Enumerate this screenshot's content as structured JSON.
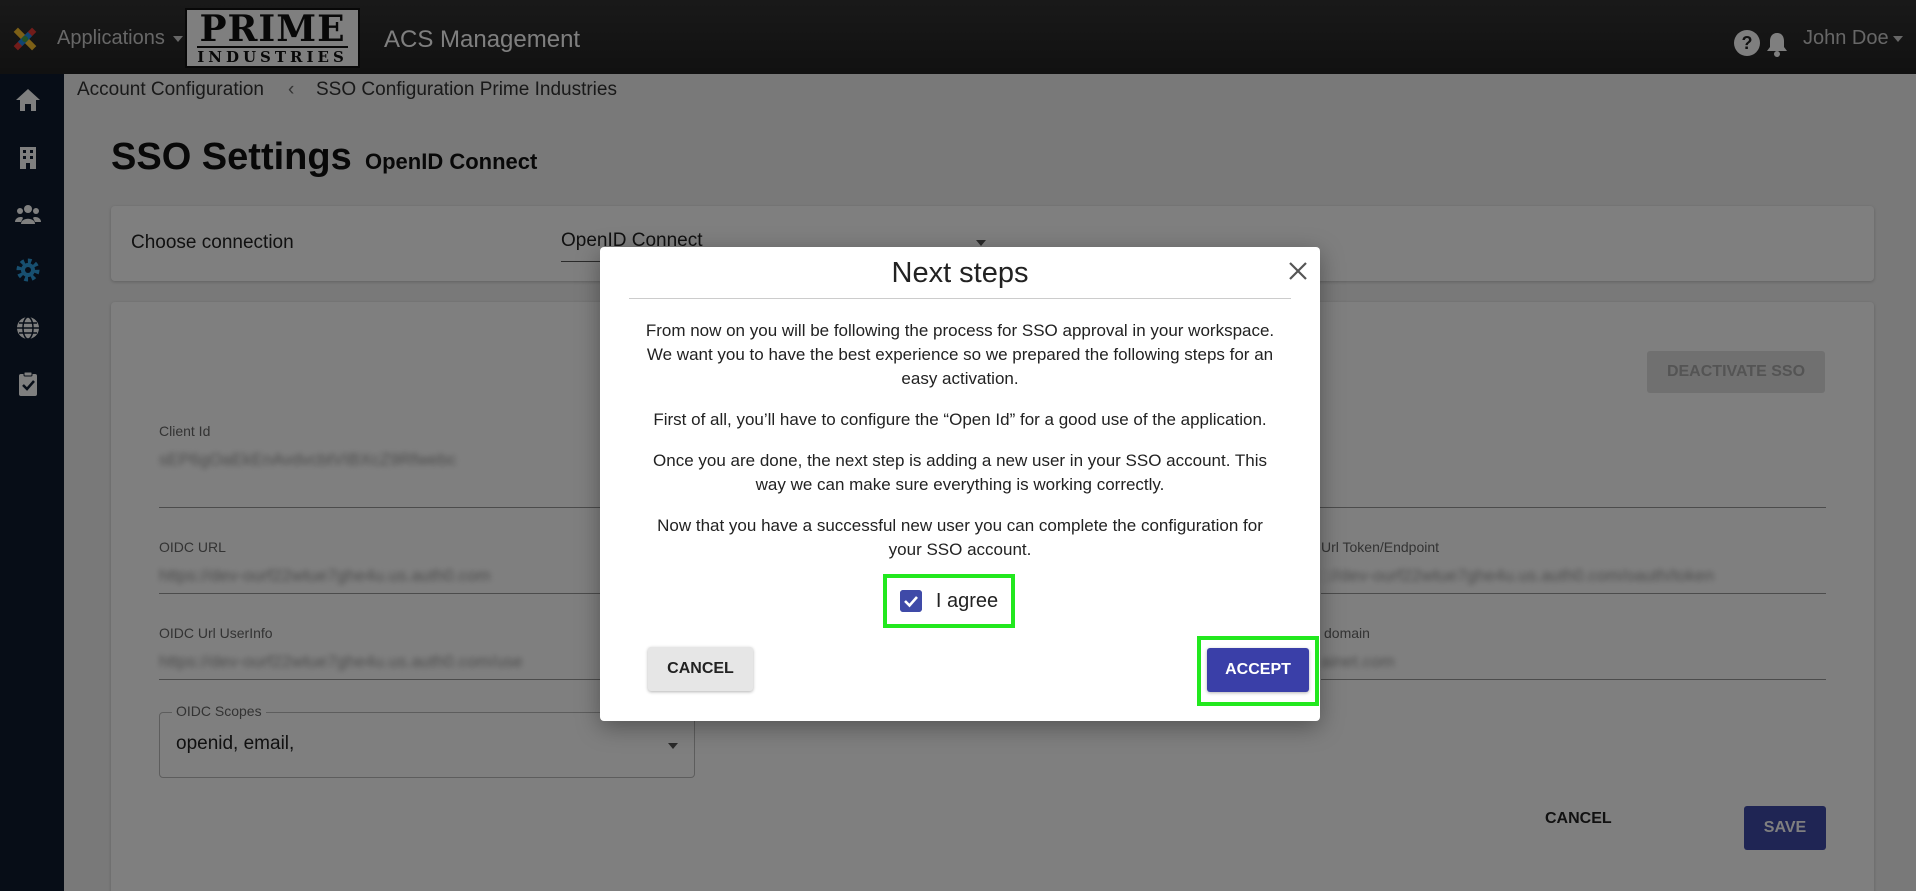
{
  "header": {
    "apps_label": "Applications",
    "brand_line1": "PRIME",
    "brand_line2": "INDUSTRIES",
    "product": "ACS Management",
    "help": "?",
    "user": "John Doe"
  },
  "sidebar": {
    "items": [
      {
        "icon": "home-icon"
      },
      {
        "icon": "building-icon"
      },
      {
        "icon": "users-icon"
      },
      {
        "icon": "gear-icon",
        "active": true
      },
      {
        "icon": "globe-icon"
      },
      {
        "icon": "clipboard-check-icon"
      }
    ]
  },
  "breadcrumb": {
    "parent": "Account Configuration",
    "separator": "‹",
    "current": "SSO Configuration Prime Industries"
  },
  "page": {
    "title": "SSO Settings",
    "subtitle": "OpenID Connect"
  },
  "connection": {
    "label": "Choose connection",
    "value": "OpenID Connect"
  },
  "settings": {
    "deactivate_label": "DEACTIVATE SSO",
    "client_id_label": "Client Id",
    "client_id_value": "sEP6gOaEkEnAvdvcbtVIBXcZ9Rfwebc",
    "oidc_url_label": "OIDC URL",
    "oidc_url_value": "https://dev-ourf22wtue7ghe4u.us.auth0.com",
    "token_label": "C Url Token/Endpoint",
    "token_value": ":://dev-ourf22wtue7ghe4u.us.auth0.com/oauth/token",
    "userinfo_label": "OIDC Url UserInfo",
    "userinfo_value": "https://dev-ourf22wtue7ghe4u.us.auth0.com/use",
    "domain_label": "l domain",
    "domain_value": "ainet.com",
    "scopes_label": "OIDC Scopes",
    "scopes_value": "openid, email,",
    "cancel_label": "CANCEL",
    "save_label": "SAVE"
  },
  "modal": {
    "title": "Next steps",
    "paragraphs": [
      "From now on you will be following the process for SSO approval in your workspace. We want you to have the best experience so we prepared the following steps for an easy activation.",
      "First of all, you’ll have to configure the “Open Id” for a good use of the application.",
      "Once you are done, the next step is adding a new user in your SSO account. This way we can make sure everything is working correctly.",
      "Now that you have a successful new user you can complete the configuration for your SSO account."
    ],
    "agree_label": "I agree",
    "agree_checked": true,
    "cancel_label": "CANCEL",
    "accept_label": "ACCEPT"
  },
  "colors": {
    "accent": "#3f4aa8",
    "highlight": "#22e81e",
    "sidebar_bg": "#0e1b2e",
    "active_icon": "#2f9fe0"
  }
}
